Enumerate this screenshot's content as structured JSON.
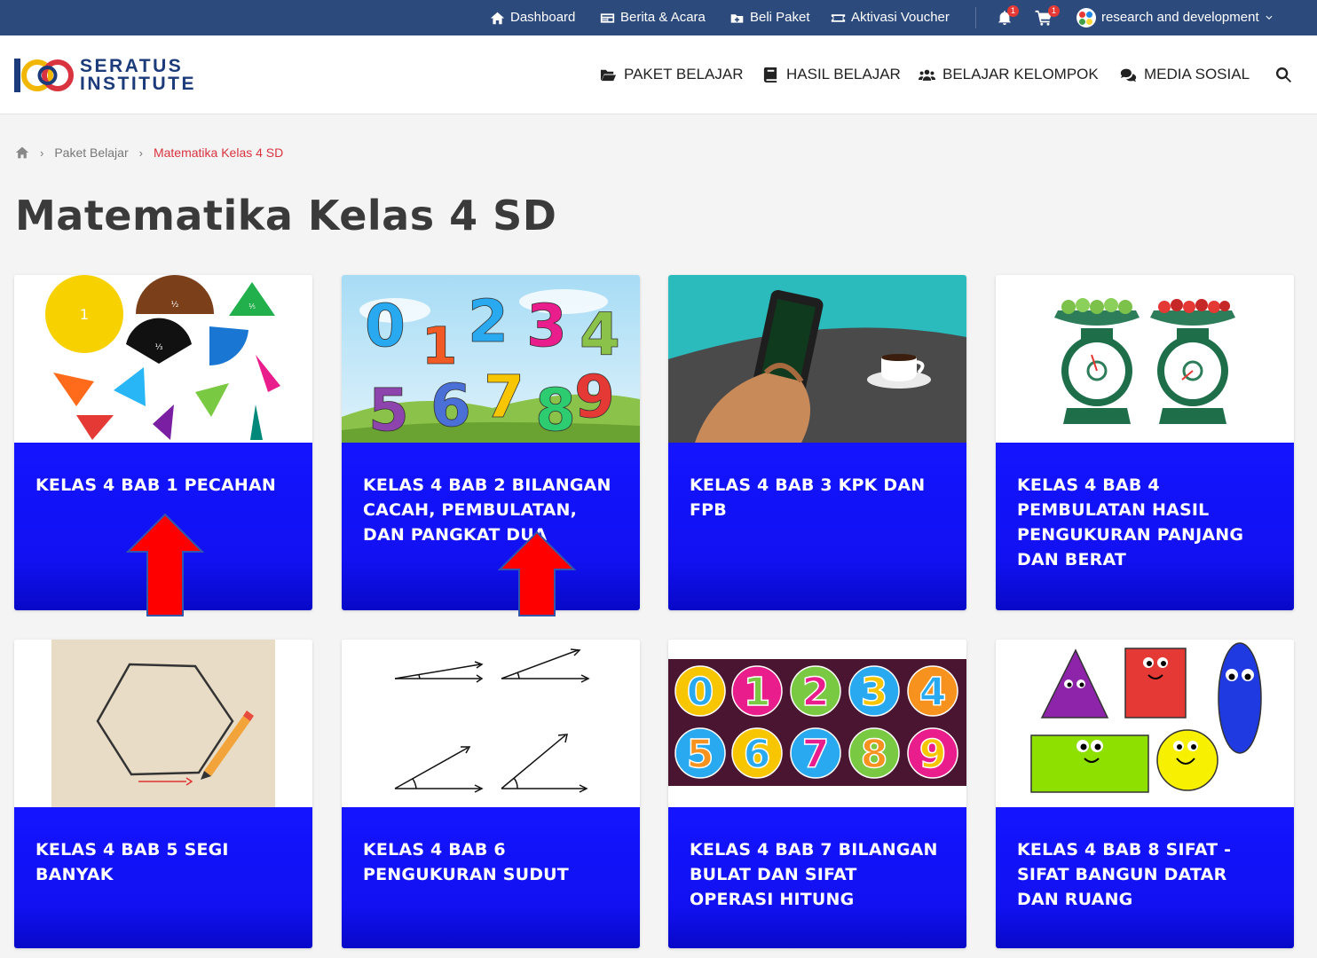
{
  "topbar": {
    "dashboard": "Dashboard",
    "berita": "Berita & Acara",
    "beli": "Beli Paket",
    "voucher": "Aktivasi Voucher",
    "notif_count": "1",
    "cart_count": "1",
    "user": "research and development"
  },
  "header": {
    "logo_line1": "SERATUS",
    "logo_line2": "INSTITUTE",
    "nav": [
      "PAKET BELAJAR",
      "HASIL BELAJAR",
      "BELAJAR KELOMPOK",
      "MEDIA SOSIAL"
    ]
  },
  "breadcrumb": {
    "items": [
      "Paket Belajar",
      "Matematika Kelas 4 SD"
    ]
  },
  "page_title": "Matematika Kelas 4 SD",
  "cards": [
    {
      "title": "KELAS 4 BAB 1 PECAHAN",
      "image": "fractions"
    },
    {
      "title": "KELAS 4 BAB 2 BILANGAN CACAH, PEMBULATAN, DAN PANGKAT DUA",
      "image": "numbers"
    },
    {
      "title": "KELAS 4 BAB 3 KPK DAN FPB",
      "image": "phone"
    },
    {
      "title": "KELAS 4 BAB 4 PEMBULATAN HASIL PENGUKURAN PANJANG DAN BERAT",
      "image": "scales"
    },
    {
      "title": "KELAS 4 BAB 5 SEGI BANYAK",
      "image": "hexagon"
    },
    {
      "title": "KELAS 4 BAB 6 PENGUKURAN SUDUT",
      "image": "angles"
    },
    {
      "title": "KELAS 4 BAB 7 BILANGAN BULAT DAN SIFAT OPERASI HITUNG",
      "image": "digits"
    },
    {
      "title": "KELAS 4 BAB 8 SIFAT - SIFAT BANGUN DATAR DAN RUANG",
      "image": "shapes"
    }
  ],
  "colors": {
    "topbar": "#2c4a7c",
    "card_body": "#1414ff",
    "breadcrumb_active": "#d9333f",
    "arrow": "#ff0000"
  }
}
